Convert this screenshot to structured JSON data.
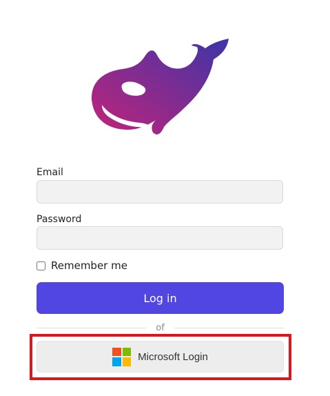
{
  "email": {
    "label": "Email",
    "value": "",
    "placeholder": ""
  },
  "password": {
    "label": "Password",
    "value": "",
    "placeholder": ""
  },
  "remember": {
    "label": "Remember me",
    "checked": false
  },
  "login_button": {
    "label": "Log in"
  },
  "divider": {
    "text": "of"
  },
  "microsoft_login": {
    "label": "Microsoft Login",
    "highlighted": true
  },
  "colors": {
    "primary": "#5146e2",
    "highlight": "#e0141a",
    "logo_gradient_start": "#c2237a",
    "logo_gradient_end": "#3d35a8"
  },
  "icons": {
    "logo": "orca-whale-logo",
    "microsoft": "microsoft-icon"
  }
}
